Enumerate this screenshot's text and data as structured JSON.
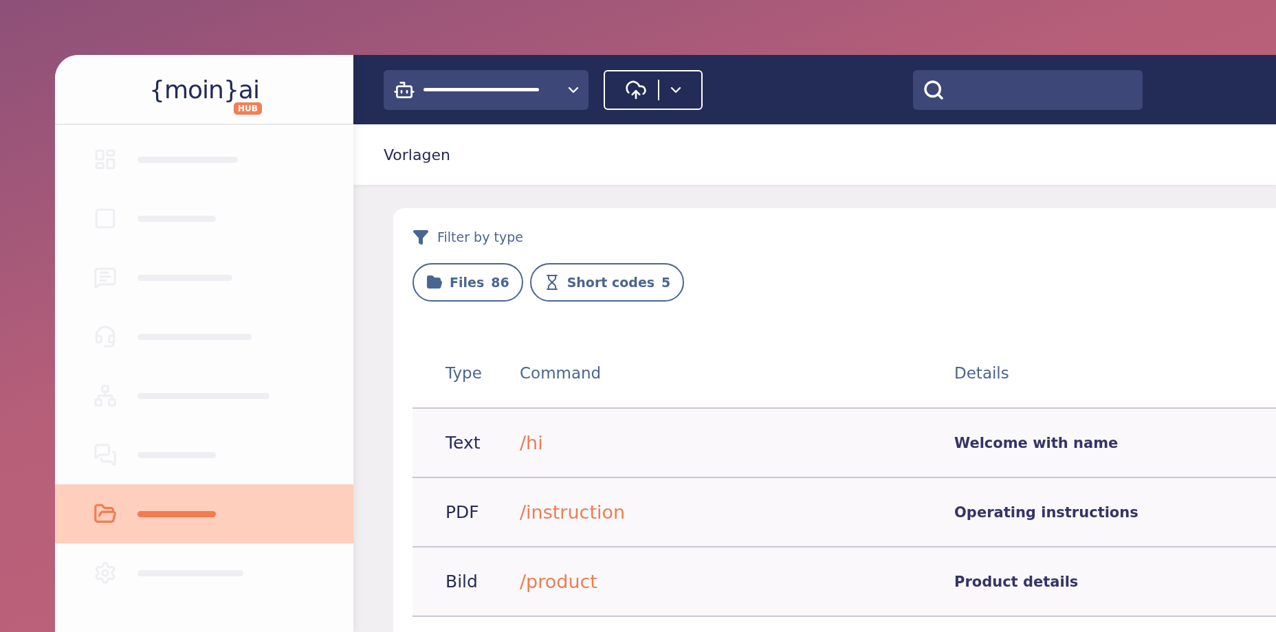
{
  "logo": {
    "text": "{moin}ai",
    "badge": "HUB"
  },
  "sidebar": {
    "items": [
      {
        "selected": false
      },
      {
        "selected": false
      },
      {
        "selected": false
      },
      {
        "selected": false
      },
      {
        "selected": false
      },
      {
        "selected": false
      },
      {
        "selected": true
      },
      {
        "selected": false
      }
    ]
  },
  "breadcrumb": "Vorlagen",
  "filter": {
    "label": "Filter by type",
    "chips": [
      {
        "label": "Files",
        "count": "86"
      },
      {
        "label": "Short codes",
        "count": "5"
      }
    ]
  },
  "table": {
    "columns": [
      "Type",
      "Command",
      "Details"
    ],
    "rows": [
      {
        "type": "Text",
        "command": "/hi",
        "details": "Welcome with name"
      },
      {
        "type": "PDF",
        "command": "/instruction",
        "details": "Operating instructions"
      },
      {
        "type": "Bild",
        "command": "/product",
        "details": "Product details"
      }
    ]
  }
}
